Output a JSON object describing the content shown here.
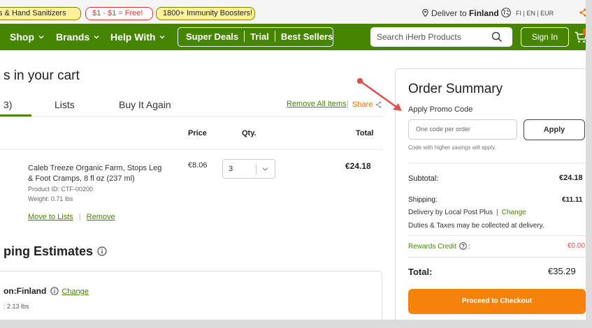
{
  "promo_bar": {
    "pills": [
      "s & Hand Sanitizers",
      "$1 - $1 = Free!",
      "1800+ Immunity Boosters!"
    ],
    "deliver_prefix": "Deliver to ",
    "deliver_country": "Finland",
    "locale": "FI | EN | EUR"
  },
  "nav": {
    "shop": "Shop",
    "brands": "Brands",
    "help_with": "Help With",
    "super_deals": "Super Deals",
    "trial": "Trial",
    "best_sellers": "Best Sellers",
    "search_placeholder": "Search iHerb Products",
    "sign_in": "Sign In"
  },
  "cart": {
    "heading": "s in your cart",
    "tabs": [
      "3)",
      "Lists",
      "Buy It Again"
    ],
    "remove_all": "Remove All Items",
    "share": "Share",
    "columns": {
      "price": "Price",
      "qty": "Qty.",
      "total": "Total"
    },
    "item": {
      "name": "Caleb Treeze Organic Farm, Stops Leg & Foot Cramps, 8 fl oz (237 ml)",
      "product_id": "Product ID: CTF-00200",
      "weight": "Weight: 0.71 lbs",
      "price": "€8.06",
      "qty": "3",
      "total": "€24.18",
      "move_to_lists": "Move to Lists",
      "remove": "Remove"
    }
  },
  "shipping": {
    "heading": "ping Estimates",
    "destination": "on:Finland",
    "change": "Change",
    "weight": ": 2.13 lbs"
  },
  "summary": {
    "title": "Order Summary",
    "promo_label": "Apply Promo Code",
    "promo_placeholder": "One code per order",
    "apply": "Apply",
    "hint": "Code with higher savings will apply.",
    "subtotal_label": "Subtotal:",
    "subtotal_value": "€24.18",
    "shipping_label": "Shipping:",
    "shipping_value": "€11.11",
    "delivery_text": "Delivery by Local Post Plus",
    "delivery_change": "Change",
    "duties_text": "Duties & Taxes may be collected at delivery.",
    "rewards_label": "Rewards Credit",
    "rewards_value": "€0.00",
    "total_label": "Total:",
    "total_value": "€35.29",
    "checkout": "Proceed to Checkout"
  },
  "colors": {
    "brand_green": "#458500",
    "accent_orange": "#f5830a",
    "annotation_red": "#d9534f"
  }
}
